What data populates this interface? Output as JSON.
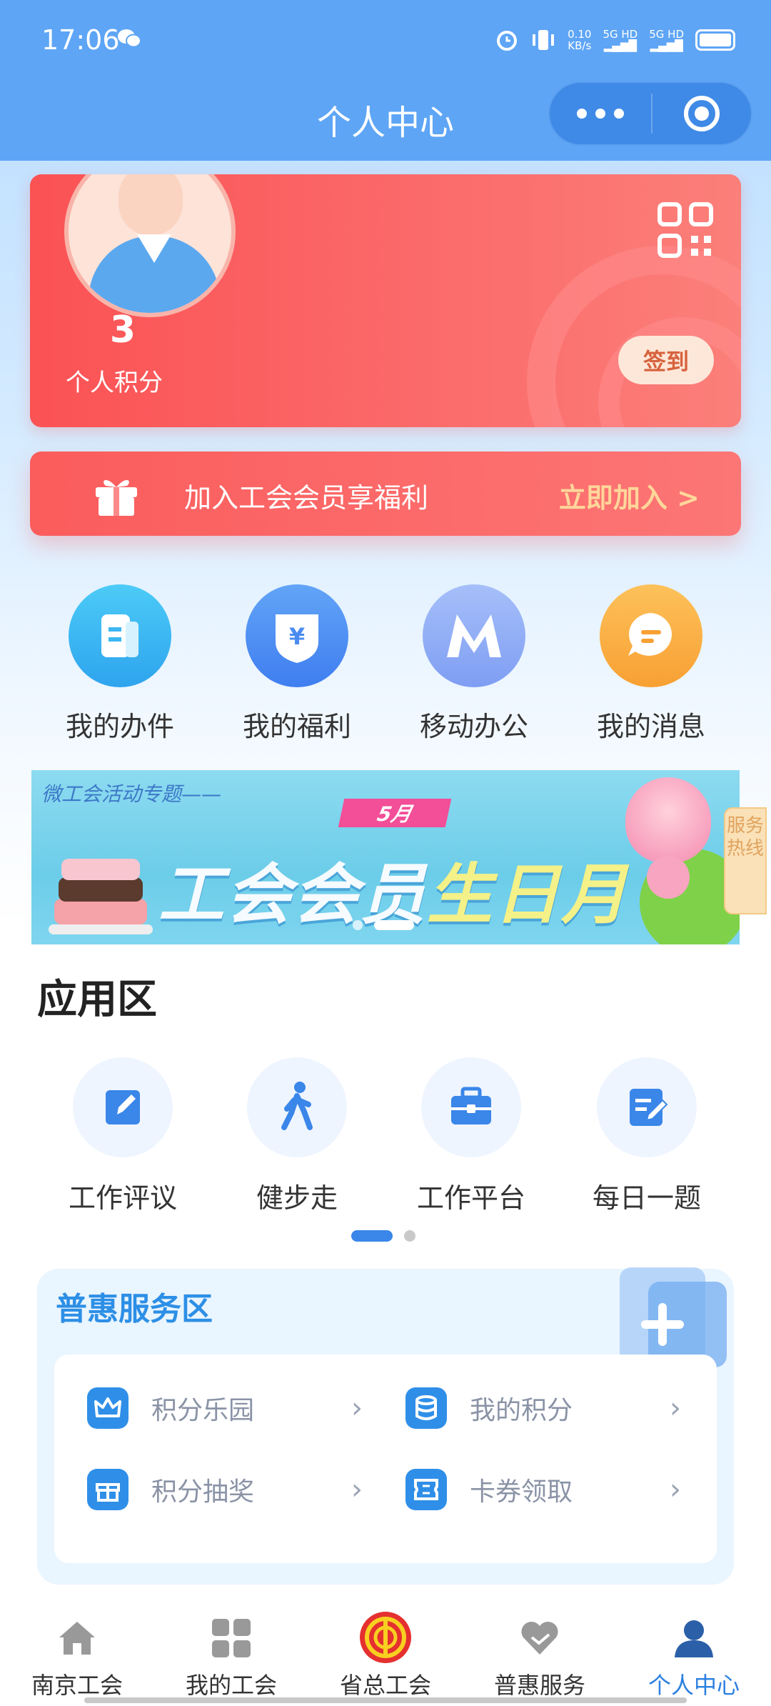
{
  "status": {
    "time": "17:06",
    "net_speed_value": "0.10",
    "net_speed_unit": "KB/s",
    "sim1": "5G HD",
    "sim2": "5G HD"
  },
  "header": {
    "title": "个人中心"
  },
  "profile": {
    "points_value": "3",
    "points_label": "个人积分",
    "checkin_label": "签到"
  },
  "join": {
    "text": "加入工会会员享福利",
    "action": "立即加入 >"
  },
  "quick_actions": [
    {
      "label": "我的办件",
      "color": "#3cb6f3",
      "icon": "document-icon"
    },
    {
      "label": "我的福利",
      "color": "#4a8cf1",
      "icon": "shield-yen-icon"
    },
    {
      "label": "移动办公",
      "color": "#8aa8f5",
      "icon": "m-logo-icon"
    },
    {
      "label": "我的消息",
      "color": "#fbb044",
      "icon": "message-icon"
    }
  ],
  "promo": {
    "subtitle": "微工会活动专题——",
    "month": "5月",
    "title_part1": "工会会员",
    "title_part2": "生日月"
  },
  "hotline": {
    "label": "服务热线"
  },
  "apps_section": {
    "title": "应用区",
    "items": [
      {
        "label": "工作评议",
        "icon": "edit-icon"
      },
      {
        "label": "健步走",
        "icon": "walking-icon"
      },
      {
        "label": "工作平台",
        "icon": "briefcase-icon"
      },
      {
        "label": "每日一题",
        "icon": "quiz-icon"
      }
    ]
  },
  "benefits": {
    "title": "普惠服务区",
    "items": [
      {
        "label": "积分乐园",
        "icon": "crown-icon"
      },
      {
        "label": "我的积分",
        "icon": "coins-icon"
      },
      {
        "label": "积分抽奖",
        "icon": "gift-icon"
      },
      {
        "label": "卡券领取",
        "icon": "ticket-icon"
      }
    ]
  },
  "tabbar": [
    {
      "label": "南京工会",
      "icon": "home-icon"
    },
    {
      "label": "我的工会",
      "icon": "grid-icon"
    },
    {
      "label": "省总工会",
      "icon": "union-emblem-icon"
    },
    {
      "label": "普惠服务",
      "icon": "heart-hand-icon"
    },
    {
      "label": "个人中心",
      "icon": "person-icon",
      "active": true
    }
  ],
  "colors": {
    "accent": "#2d80e0",
    "header_bg": "#5ea5f5",
    "card_red": "#fb5254"
  }
}
